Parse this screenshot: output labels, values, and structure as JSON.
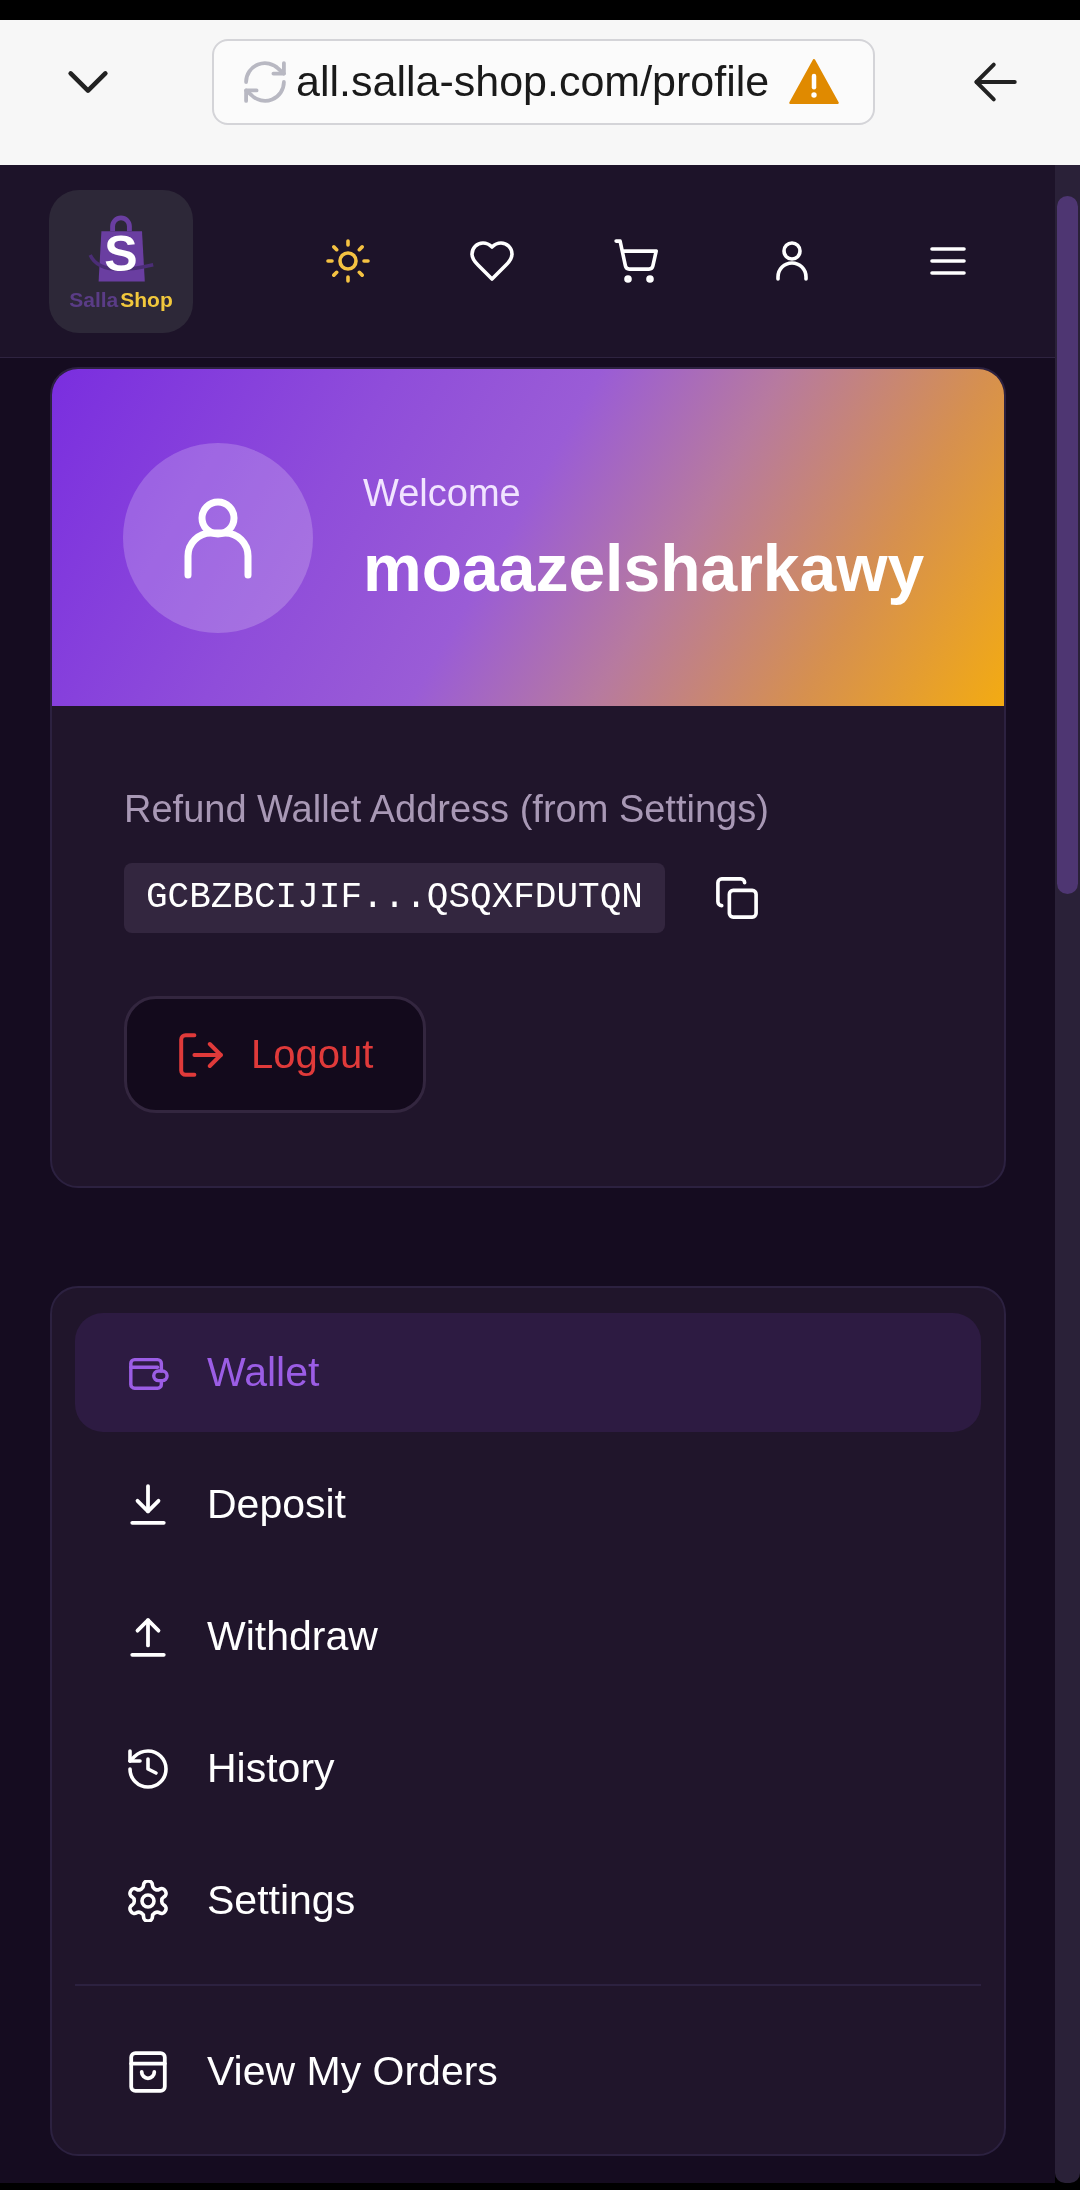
{
  "browser": {
    "url": "all.salla-shop.com/profile"
  },
  "header": {
    "logo": {
      "letter": "S",
      "words": [
        "Salla",
        "Shop"
      ]
    }
  },
  "profile": {
    "greeting": "Welcome",
    "username": "moaazelsharkawy",
    "wallet_label": "Refund Wallet Address (from Settings)",
    "wallet_address": "GCBZBCIJIF...QSQXFDUTQN",
    "logout_label": "Logout"
  },
  "menu": {
    "sections": [
      {
        "items": [
          {
            "kind": "wallet",
            "label": "Wallet",
            "selected": true
          },
          {
            "kind": "deposit",
            "label": "Deposit",
            "selected": false
          },
          {
            "kind": "withdraw",
            "label": "Withdraw",
            "selected": false
          },
          {
            "kind": "history",
            "label": "History",
            "selected": false
          },
          {
            "kind": "settings",
            "label": "Settings",
            "selected": false
          }
        ]
      },
      {
        "items": [
          {
            "kind": "orders",
            "label": "View My Orders",
            "selected": false
          }
        ]
      }
    ]
  }
}
